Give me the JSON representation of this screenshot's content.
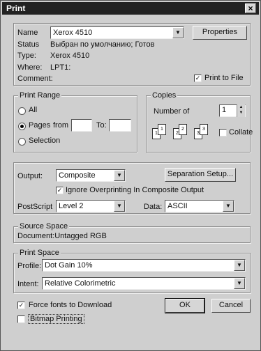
{
  "window": {
    "title": "Print",
    "close_glyph": "×"
  },
  "printer": {
    "name_label": "Name",
    "name_value": "Xerox 4510",
    "properties_label": "Properties",
    "status_label": "Status",
    "status_value": "Выбран по умолчанию; Готов",
    "type_label": "Type:",
    "type_value": "Xerox 4510",
    "where_label": "Where:",
    "where_value": "LPT1:",
    "comment_label": "Comment:",
    "print_to_file_label": "Print to File",
    "print_to_file_checked": true
  },
  "print_range": {
    "title": "Print Range",
    "all_label": "All",
    "pages_label": "Pages",
    "from_label": "from",
    "to_label": "To:",
    "selection_label": "Selection",
    "selected": "pages"
  },
  "copies": {
    "title": "Copies",
    "number_label": "Number of",
    "number_value": "1",
    "collate_label": "Collate",
    "collate_checked": false
  },
  "output": {
    "output_label": "Output:",
    "output_value": "Composite",
    "separation_setup_label": "Separation Setup...",
    "ignore_overprinting_label": "Ignore Overprinting In Composite Output",
    "ignore_overprinting_checked": true,
    "postscript_label": "PostScript",
    "postscript_value": "Level 2",
    "data_label": "Data:",
    "data_value": "ASCII"
  },
  "source_space": {
    "title": "Source Space",
    "value": "Document:Untagged RGB"
  },
  "print_space": {
    "title": "Print Space",
    "profile_label": "Profile:",
    "profile_value": "Dot Gain 10%",
    "intent_label": "Intent:",
    "intent_value": "Relative Colorimetric"
  },
  "footer": {
    "force_fonts_label": "Force fonts to Download",
    "force_fonts_checked": true,
    "bitmap_label": "Bitmap Printing",
    "bitmap_checked": false,
    "ok_label": "OK",
    "cancel_label": "Cancel"
  },
  "icons": {
    "combo_arrow": "▼",
    "spin_up": "▲",
    "spin_down": "▼",
    "check": "✓"
  }
}
